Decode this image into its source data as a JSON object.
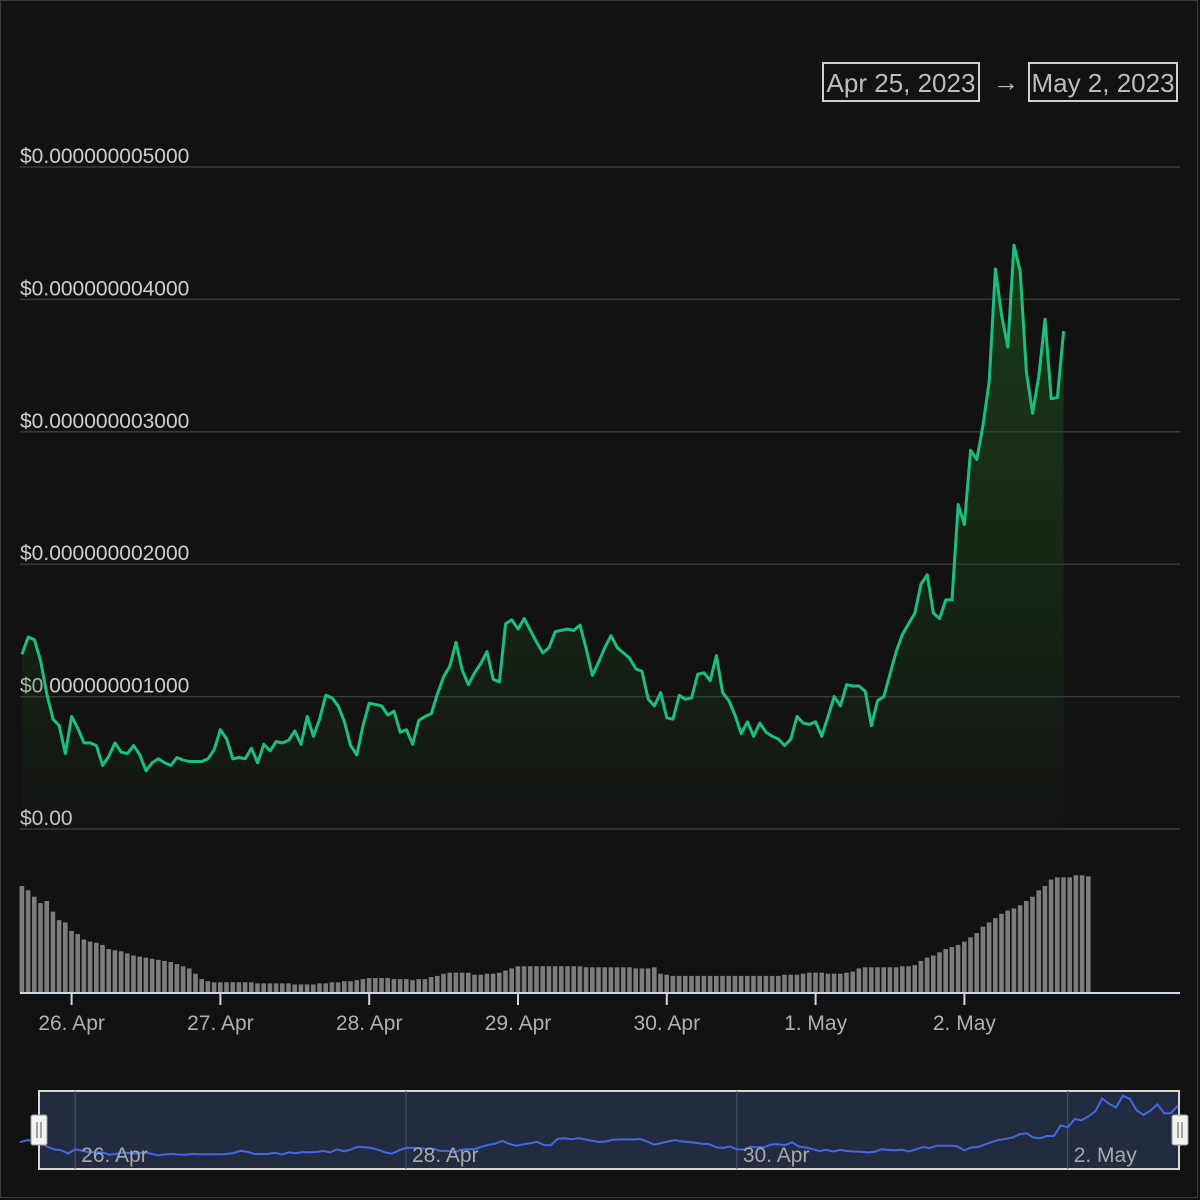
{
  "range_selector": {
    "from": "Apr 25, 2023",
    "arrow": "→",
    "to": "May 2, 2023"
  },
  "colors": {
    "background": "#121212",
    "price_line": "#18c07f",
    "volume_bar": "#7d7d7d",
    "navigator_line": "#4169e1",
    "gridline": "#3a3a3a",
    "text": "#cfcfcf"
  },
  "chart_data": [
    {
      "type": "line",
      "title": "",
      "xlabel": "",
      "ylabel": "",
      "x_start": "2023-04-25T16:00",
      "x_step_hours": 1,
      "x_ticks": [
        {
          "label": "26. Apr",
          "date": "2023-04-26"
        },
        {
          "label": "27. Apr",
          "date": "2023-04-27"
        },
        {
          "label": "28. Apr",
          "date": "2023-04-28"
        },
        {
          "label": "29. Apr",
          "date": "2023-04-29"
        },
        {
          "label": "30. Apr",
          "date": "2023-04-30"
        },
        {
          "label": "1. May",
          "date": "2023-05-01"
        },
        {
          "label": "2. May",
          "date": "2023-05-02"
        }
      ],
      "y_ticks": [
        {
          "label": "$0.00",
          "value": 0
        },
        {
          "label": "$0.000000001000",
          "value": 1.0
        },
        {
          "label": "$0.000000002000",
          "value": 2.0
        },
        {
          "label": "$0.000000003000",
          "value": 3.0
        },
        {
          "label": "$0.000000004000",
          "value": 4.0
        },
        {
          "label": "$0.000000005000",
          "value": 5.0
        }
      ],
      "y_unit": "price in units of $0.000000001",
      "ylim": [
        0,
        5.0
      ],
      "grid": true,
      "series": [
        {
          "values": [
            1.32,
            1.45,
            1.43,
            1.27,
            1.02,
            0.83,
            0.78,
            0.57,
            0.85,
            0.76,
            0.65,
            0.65,
            0.63,
            0.48,
            0.55,
            0.65,
            0.58,
            0.57,
            0.63,
            0.56,
            0.44,
            0.5,
            0.53,
            0.5,
            0.48,
            0.54,
            0.52,
            0.51,
            0.51,
            0.51,
            0.53,
            0.6,
            0.75,
            0.68,
            0.53,
            0.54,
            0.53,
            0.61,
            0.5,
            0.64,
            0.59,
            0.66,
            0.65,
            0.67,
            0.74,
            0.64,
            0.85,
            0.7,
            0.83,
            1.01,
            0.99,
            0.93,
            0.81,
            0.63,
            0.56,
            0.78,
            0.95,
            0.94,
            0.93,
            0.86,
            0.89,
            0.73,
            0.75,
            0.64,
            0.82,
            0.85,
            0.87,
            1.02,
            1.15,
            1.23,
            1.41,
            1.2,
            1.09,
            1.18,
            1.25,
            1.34,
            1.13,
            1.11,
            1.55,
            1.58,
            1.51,
            1.59,
            1.5,
            1.41,
            1.33,
            1.37,
            1.49,
            1.5,
            1.51,
            1.5,
            1.54,
            1.36,
            1.16,
            1.26,
            1.37,
            1.46,
            1.37,
            1.33,
            1.29,
            1.21,
            1.19,
            0.98,
            0.93,
            1.03,
            0.84,
            0.83,
            1.01,
            0.98,
            0.99,
            1.17,
            1.18,
            1.12,
            1.31,
            1.03,
            0.97,
            0.86,
            0.72,
            0.81,
            0.7,
            0.8,
            0.73,
            0.7,
            0.68,
            0.63,
            0.68,
            0.85,
            0.8,
            0.79,
            0.81,
            0.7,
            0.85,
            1.0,
            0.93,
            1.09,
            1.08,
            1.08,
            1.04,
            0.78,
            0.97,
            1.0,
            1.17,
            1.34,
            1.47,
            1.55,
            1.63,
            1.85,
            1.92,
            1.63,
            1.59,
            1.73,
            1.73,
            2.45,
            2.3,
            2.86,
            2.79,
            3.05,
            3.38,
            4.23,
            3.88,
            3.64,
            4.41,
            4.21,
            3.45,
            3.14,
            3.42,
            3.85,
            3.25,
            3.26,
            3.76
          ]
        }
      ]
    },
    {
      "type": "bar",
      "title": "",
      "xlabel": "",
      "ylabel": "",
      "series": [
        {
          "values": [
            100,
            96,
            90,
            84,
            86,
            76,
            68,
            66,
            58,
            55,
            50,
            48,
            47,
            45,
            41,
            40,
            39,
            37,
            35,
            34,
            33,
            32,
            31,
            30,
            29,
            27,
            25,
            23,
            18,
            13,
            11,
            10,
            10,
            10,
            10,
            10,
            10,
            10,
            9,
            9,
            9,
            9,
            9,
            9,
            8,
            8,
            8,
            8,
            9,
            9,
            10,
            10,
            11,
            11,
            12,
            13,
            14,
            14,
            14,
            14,
            13,
            13,
            13,
            12,
            13,
            13,
            15,
            16,
            18,
            19,
            19,
            19,
            19,
            17,
            17,
            18,
            18,
            19,
            21,
            23,
            25,
            25,
            25,
            25,
            25,
            25,
            25,
            25,
            25,
            25,
            25,
            24,
            24,
            24,
            24,
            24,
            24,
            24,
            24,
            23,
            23,
            23,
            24,
            18,
            17,
            16,
            16,
            16,
            16,
            16,
            16,
            16,
            16,
            16,
            16,
            16,
            16,
            16,
            16,
            16,
            16,
            16,
            16,
            17,
            17,
            17,
            18,
            19,
            19,
            19,
            18,
            18,
            18,
            19,
            20,
            23,
            24,
            24,
            24,
            24,
            24,
            24,
            25,
            25,
            26,
            30,
            33,
            35,
            38,
            41,
            43,
            45,
            48,
            52,
            56,
            62,
            66,
            70,
            74,
            77,
            79,
            82,
            86,
            90,
            96,
            100,
            106,
            108,
            108,
            108,
            110,
            110,
            109
          ]
        }
      ]
    },
    {
      "type": "line",
      "title": "",
      "xlabel": "",
      "ylabel": "",
      "x_ticks": [
        {
          "label": "26. Apr",
          "date": "2023-04-26"
        },
        {
          "label": "28. Apr",
          "date": "2023-04-28"
        },
        {
          "label": "30. Apr",
          "date": "2023-04-30"
        },
        {
          "label": "2. May",
          "date": "2023-05-02"
        }
      ],
      "selected_range": [
        "2023-04-25T16:00",
        "2023-05-02T16:00"
      ],
      "grid": true
    }
  ]
}
